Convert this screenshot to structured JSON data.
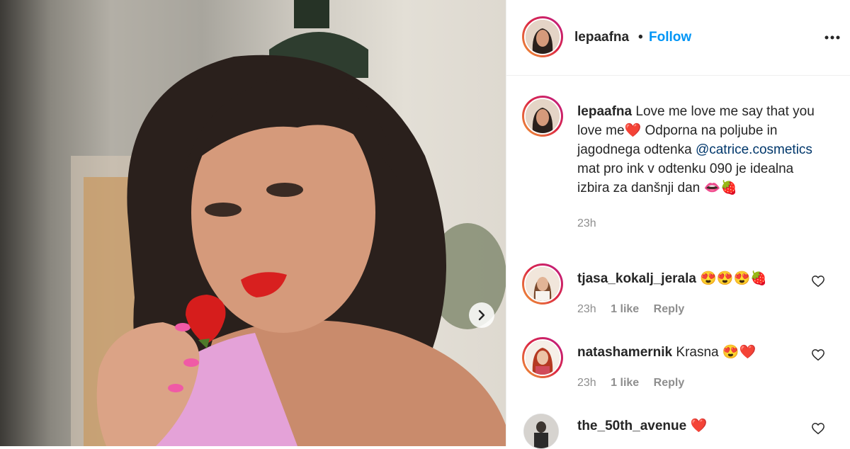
{
  "post": {
    "author": "lepaafna",
    "separator": "•",
    "follow_label": "Follow",
    "caption_text": "Love me love me say that you love me",
    "caption_heart": "❤️",
    "caption_text2": " Odporna na poljube in jagodnega odtenka ",
    "mention": "@catrice.cosmetics",
    "caption_text3": " mat pro ink v odtenku 090 je idealna izbira za danšnji dan ",
    "caption_emojis": "👄🍓",
    "time": "23h"
  },
  "comments": [
    {
      "user": "tjasa_kokalj_jerala",
      "text": "",
      "emojis": "😍😍😍🍓",
      "time": "23h",
      "likes": "1 like",
      "reply": "Reply"
    },
    {
      "user": "natashamernik",
      "text": "Krasna",
      "emojis": "😍❤️",
      "time": "23h",
      "likes": "1 like",
      "reply": "Reply"
    },
    {
      "user": "the_50th_avenue",
      "text": "",
      "emojis": "❤️",
      "time": "",
      "likes": "",
      "reply": ""
    }
  ],
  "colors": {
    "accent": "#0095f6",
    "mention": "#00376b",
    "text": "#262626",
    "muted": "#8e8e8e"
  },
  "icons": {
    "more": "more-options-icon",
    "next": "chevron-right-icon",
    "like": "heart-outline-icon"
  }
}
